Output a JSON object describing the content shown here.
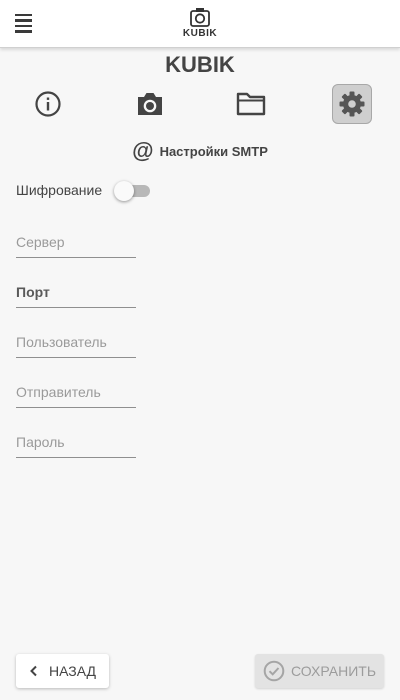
{
  "header": {
    "logo_text": "KUBIK",
    "title": "KUBIK"
  },
  "tabs": [
    {
      "icon": "info-icon",
      "active": false
    },
    {
      "icon": "camera-icon",
      "active": false
    },
    {
      "icon": "folder-icon",
      "active": false
    },
    {
      "icon": "gear-icon",
      "active": true
    }
  ],
  "section": {
    "title": "Настройки SMTP",
    "icon": "at-icon"
  },
  "encryption": {
    "label": "Шифрование",
    "enabled": false
  },
  "fields": {
    "server": {
      "placeholder": "Сервер",
      "value": ""
    },
    "port": {
      "placeholder": "Порт",
      "value": ""
    },
    "user": {
      "placeholder": "Пользователь",
      "value": ""
    },
    "sender": {
      "placeholder": "Отправитель",
      "value": ""
    },
    "password": {
      "placeholder": "Пароль",
      "value": ""
    }
  },
  "footer": {
    "back_label": "НАЗАД",
    "save_label": "СОХРАНИТЬ",
    "save_enabled": false
  }
}
